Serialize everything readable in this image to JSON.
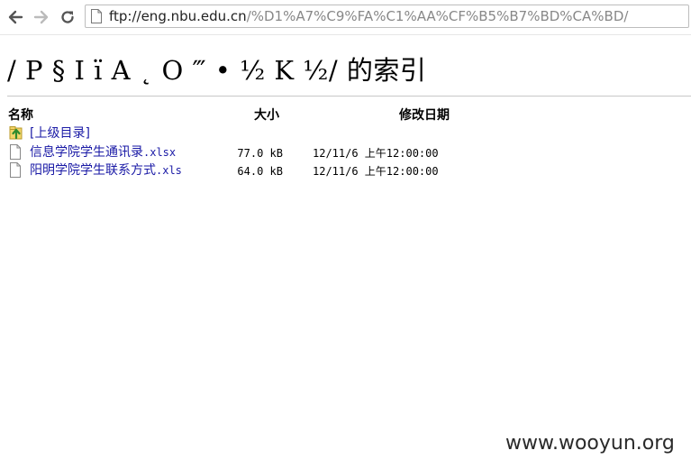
{
  "browser": {
    "url_host": "ftp://eng.nbu.edu.cn",
    "url_path": "/%D1%A7%C9%FA%C1%AA%CF%B5%B7%BD%CA%BD/"
  },
  "page": {
    "title_garbled": "/ P § I ï A ˛ O ‴ • ½ K ½/",
    "title_suffix": "的索引"
  },
  "listing": {
    "headers": {
      "name": "名称",
      "size": "大小",
      "date": "修改日期"
    },
    "parent_label": "[上级目录]",
    "files": [
      {
        "name": "信息学院学生通讯录",
        "ext": ".xlsx",
        "size": "77.0 kB",
        "date": "12/11/6 上午12:00:00"
      },
      {
        "name": "阳明学院学生联系方式",
        "ext": ".xls",
        "size": "64.0 kB",
        "date": "12/11/6 上午12:00:00"
      }
    ]
  },
  "watermark": "www.wooyun.org",
  "icons": {
    "back": "arrow-left-icon",
    "forward": "arrow-right-icon",
    "reload": "reload-icon",
    "page": "page-icon",
    "parent": "folder-up-icon",
    "file": "file-icon"
  },
  "colors": {
    "link": "#1a1aa6",
    "url_path": "#888888",
    "rule": "#c8c8c8"
  }
}
